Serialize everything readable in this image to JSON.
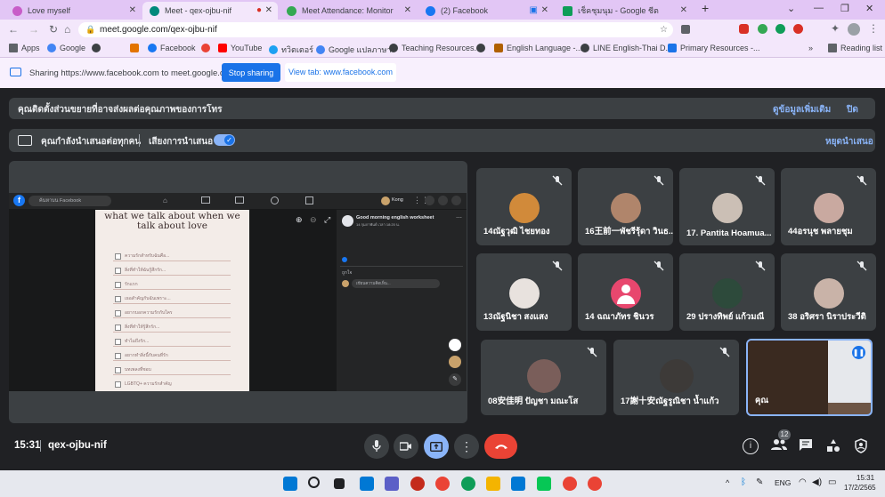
{
  "tabs": [
    {
      "title": "Love myself",
      "color": "#c85dc8"
    },
    {
      "title": "Meet - qex-ojbu-nif",
      "color": "#00897b"
    },
    {
      "title": "Meet Attendance: Monitor",
      "color": "#34a853"
    },
    {
      "title": "(2) Facebook",
      "color": "#1877f2"
    },
    {
      "title": "เช็คชุมนุม - Google ชีต",
      "color": "#0f9d58"
    }
  ],
  "address": {
    "url": "meet.google.com/qex-ojbu-nif"
  },
  "bookmarks": [
    {
      "label": "Apps"
    },
    {
      "label": "Google"
    },
    {
      "label": ""
    },
    {
      "label": "Facebook"
    },
    {
      "label": ""
    },
    {
      "label": "YouTube"
    },
    {
      "label": "ทวิตเตอร์"
    },
    {
      "label": "Google แปลภาษา"
    },
    {
      "label": "Teaching Resources..."
    },
    {
      "label": ""
    },
    {
      "label": "English Language -..."
    },
    {
      "label": "LINE English-Thai D..."
    },
    {
      "label": "Primary Resources -..."
    },
    {
      "label": "Reading list"
    }
  ],
  "sharebar": {
    "text": "Sharing https://www.facebook.com to meet.google.com",
    "stop": "Stop sharing",
    "view": "View tab: www.facebook.com"
  },
  "banner1": {
    "text": "คุณติดตั้งส่วนขยายที่อาจส่งผลต่อคุณภาพของการโทร",
    "more": "ดูข้อมูลเพิ่มเติม",
    "close": "ปิด"
  },
  "banner2": {
    "text": "คุณกำลังนำเสนอต่อทุกคน",
    "audio": "เสียงการนำเสนอ",
    "stop": "หยุดนำเสนอ"
  },
  "share": {
    "search": "ค้นหาบน Facebook",
    "user": "Kong",
    "post_title": "what we talk about when we talk about love",
    "items": [
      "ความรักสำหรับฉันคือ...",
      "สิ่งที่ทำให้ฉันรู้สึกรัก...",
      "รักแรก",
      "เธอสำคัญกับฉันเพราะ...",
      "อยากบอกความรักกับใคร",
      "สิ่งที่ทำให้รู้สึกรัก...",
      "ทำไมถึงรัก...",
      "อยากทำสิ่งนี้กับคนที่รัก",
      "บทเพลงที่ชอบ",
      "LGBTQ+ ความรักสำคัญ"
    ],
    "group": "Good morning english worksheet",
    "group_sub": "14 กุมภาพันธ์ เวลา 18:20 น.",
    "like": "ถูกใจ",
    "comment_ph": "เขียนความคิดเห็น..."
  },
  "participants": [
    {
      "name": "14ณัฐวุฒิ ไชยทอง",
      "av": "#d18a3a"
    },
    {
      "name": "16王前一พัชรีรุ้ดา วินธ...",
      "av": "#b0856b"
    },
    {
      "name": "17. Pantita Hoamua...",
      "av": "#cbbfb5"
    },
    {
      "name": "44อรนุช พลายชุม",
      "av": "#c9a9a0"
    },
    {
      "name": "13ณัฐนิชา สงแสง",
      "av": "#e8e2de"
    },
    {
      "name": "14 ฉณาภัทร ชินวร",
      "av": "#e8476e"
    },
    {
      "name": "29 ปรางทิพย์ แก้วมณี",
      "av": "#2d4a3b"
    },
    {
      "name": "38 อริศรา นิราประวีติ",
      "av": "#c9b3a8"
    },
    {
      "name": "08安佳明 ปัญชา มณะโส",
      "av": "#7a5e5a"
    },
    {
      "name": "17謝十安ณัฐรูณิชา น้ำแก้ว",
      "av": "#3d3a38"
    },
    {
      "name": "คุณ",
      "av": "#5a3d2a"
    }
  ],
  "bottom": {
    "time": "15:31",
    "code": "qex-ojbu-nif",
    "people_count": "12"
  },
  "taskbar": {
    "lang": "ENG",
    "time": "15:31",
    "date": "17/2/2565"
  },
  "colors": {
    "accent": "#8ab4f8",
    "end_call": "#ea4335",
    "share_active": "#8ab4f8"
  }
}
